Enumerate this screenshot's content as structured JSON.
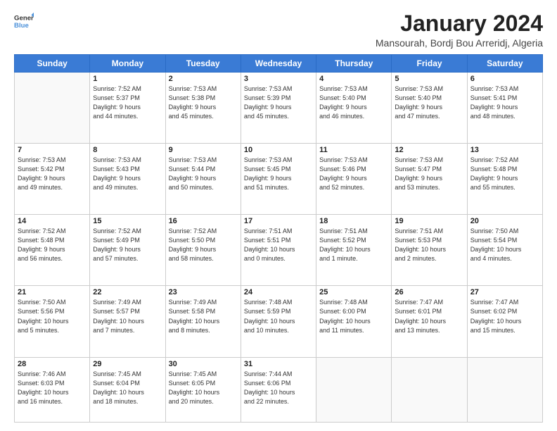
{
  "logo": {
    "line1": "General",
    "line2": "Blue"
  },
  "title": "January 2024",
  "location": "Mansourah, Bordj Bou Arreridj, Algeria",
  "days_of_week": [
    "Sunday",
    "Monday",
    "Tuesday",
    "Wednesday",
    "Thursday",
    "Friday",
    "Saturday"
  ],
  "weeks": [
    [
      {
        "day": "",
        "info": ""
      },
      {
        "day": "1",
        "info": "Sunrise: 7:52 AM\nSunset: 5:37 PM\nDaylight: 9 hours\nand 44 minutes."
      },
      {
        "day": "2",
        "info": "Sunrise: 7:53 AM\nSunset: 5:38 PM\nDaylight: 9 hours\nand 45 minutes."
      },
      {
        "day": "3",
        "info": "Sunrise: 7:53 AM\nSunset: 5:39 PM\nDaylight: 9 hours\nand 45 minutes."
      },
      {
        "day": "4",
        "info": "Sunrise: 7:53 AM\nSunset: 5:40 PM\nDaylight: 9 hours\nand 46 minutes."
      },
      {
        "day": "5",
        "info": "Sunrise: 7:53 AM\nSunset: 5:40 PM\nDaylight: 9 hours\nand 47 minutes."
      },
      {
        "day": "6",
        "info": "Sunrise: 7:53 AM\nSunset: 5:41 PM\nDaylight: 9 hours\nand 48 minutes."
      }
    ],
    [
      {
        "day": "7",
        "info": "Sunrise: 7:53 AM\nSunset: 5:42 PM\nDaylight: 9 hours\nand 49 minutes."
      },
      {
        "day": "8",
        "info": "Sunrise: 7:53 AM\nSunset: 5:43 PM\nDaylight: 9 hours\nand 49 minutes."
      },
      {
        "day": "9",
        "info": "Sunrise: 7:53 AM\nSunset: 5:44 PM\nDaylight: 9 hours\nand 50 minutes."
      },
      {
        "day": "10",
        "info": "Sunrise: 7:53 AM\nSunset: 5:45 PM\nDaylight: 9 hours\nand 51 minutes."
      },
      {
        "day": "11",
        "info": "Sunrise: 7:53 AM\nSunset: 5:46 PM\nDaylight: 9 hours\nand 52 minutes."
      },
      {
        "day": "12",
        "info": "Sunrise: 7:53 AM\nSunset: 5:47 PM\nDaylight: 9 hours\nand 53 minutes."
      },
      {
        "day": "13",
        "info": "Sunrise: 7:52 AM\nSunset: 5:48 PM\nDaylight: 9 hours\nand 55 minutes."
      }
    ],
    [
      {
        "day": "14",
        "info": "Sunrise: 7:52 AM\nSunset: 5:48 PM\nDaylight: 9 hours\nand 56 minutes."
      },
      {
        "day": "15",
        "info": "Sunrise: 7:52 AM\nSunset: 5:49 PM\nDaylight: 9 hours\nand 57 minutes."
      },
      {
        "day": "16",
        "info": "Sunrise: 7:52 AM\nSunset: 5:50 PM\nDaylight: 9 hours\nand 58 minutes."
      },
      {
        "day": "17",
        "info": "Sunrise: 7:51 AM\nSunset: 5:51 PM\nDaylight: 10 hours\nand 0 minutes."
      },
      {
        "day": "18",
        "info": "Sunrise: 7:51 AM\nSunset: 5:52 PM\nDaylight: 10 hours\nand 1 minute."
      },
      {
        "day": "19",
        "info": "Sunrise: 7:51 AM\nSunset: 5:53 PM\nDaylight: 10 hours\nand 2 minutes."
      },
      {
        "day": "20",
        "info": "Sunrise: 7:50 AM\nSunset: 5:54 PM\nDaylight: 10 hours\nand 4 minutes."
      }
    ],
    [
      {
        "day": "21",
        "info": "Sunrise: 7:50 AM\nSunset: 5:56 PM\nDaylight: 10 hours\nand 5 minutes."
      },
      {
        "day": "22",
        "info": "Sunrise: 7:49 AM\nSunset: 5:57 PM\nDaylight: 10 hours\nand 7 minutes."
      },
      {
        "day": "23",
        "info": "Sunrise: 7:49 AM\nSunset: 5:58 PM\nDaylight: 10 hours\nand 8 minutes."
      },
      {
        "day": "24",
        "info": "Sunrise: 7:48 AM\nSunset: 5:59 PM\nDaylight: 10 hours\nand 10 minutes."
      },
      {
        "day": "25",
        "info": "Sunrise: 7:48 AM\nSunset: 6:00 PM\nDaylight: 10 hours\nand 11 minutes."
      },
      {
        "day": "26",
        "info": "Sunrise: 7:47 AM\nSunset: 6:01 PM\nDaylight: 10 hours\nand 13 minutes."
      },
      {
        "day": "27",
        "info": "Sunrise: 7:47 AM\nSunset: 6:02 PM\nDaylight: 10 hours\nand 15 minutes."
      }
    ],
    [
      {
        "day": "28",
        "info": "Sunrise: 7:46 AM\nSunset: 6:03 PM\nDaylight: 10 hours\nand 16 minutes."
      },
      {
        "day": "29",
        "info": "Sunrise: 7:45 AM\nSunset: 6:04 PM\nDaylight: 10 hours\nand 18 minutes."
      },
      {
        "day": "30",
        "info": "Sunrise: 7:45 AM\nSunset: 6:05 PM\nDaylight: 10 hours\nand 20 minutes."
      },
      {
        "day": "31",
        "info": "Sunrise: 7:44 AM\nSunset: 6:06 PM\nDaylight: 10 hours\nand 22 minutes."
      },
      {
        "day": "",
        "info": ""
      },
      {
        "day": "",
        "info": ""
      },
      {
        "day": "",
        "info": ""
      }
    ]
  ]
}
